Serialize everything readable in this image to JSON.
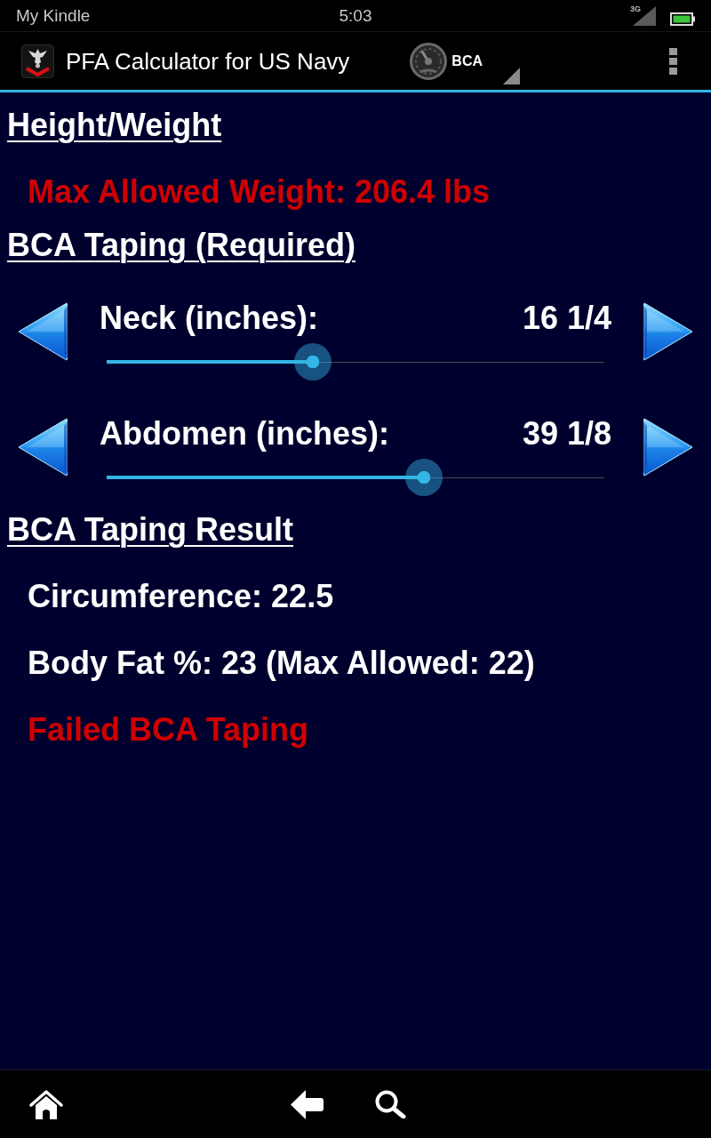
{
  "status_bar": {
    "device_name": "My Kindle",
    "time": "5:03",
    "network": "3G"
  },
  "action_bar": {
    "title": "PFA Calculator for US Navy",
    "mode_spinner": {
      "value": "BCA"
    }
  },
  "content": [
    {
      "kind": "heading",
      "text": "Height/Weight"
    },
    {
      "kind": "alert",
      "text": "Max Allowed Weight: 206.4 lbs"
    },
    {
      "kind": "heading",
      "text": "BCA Taping (Required)"
    },
    {
      "kind": "measurement",
      "label": "Neck (inches):",
      "value": "16 1/4",
      "level": 0.414
    },
    {
      "kind": "measurement",
      "label": "Abdomen (inches):",
      "value": "39 1/8",
      "level": 0.638
    },
    {
      "kind": "heading",
      "text": "BCA Taping Result"
    },
    {
      "kind": "info",
      "text": "Circumference: 22.5"
    },
    {
      "kind": "info",
      "text": "Body Fat %: 23 (Max Allowed: 22)"
    },
    {
      "kind": "alert",
      "text": "Failed BCA Taping"
    }
  ]
}
